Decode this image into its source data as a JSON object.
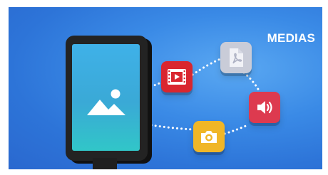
{
  "title": "MEDIAS",
  "colors": {
    "background": "#3a8ae6",
    "kiosk_body": "#232323",
    "kiosk_screen": "#3fb1e8",
    "video_tile": "#d9262f",
    "document_tile": "#c9ccd8",
    "audio_tile": "#dd3a4f",
    "photo_tile": "#f0b627"
  },
  "icons": [
    "image-icon",
    "film-play-icon",
    "pdf-document-icon",
    "speaker-icon",
    "camera-icon"
  ]
}
